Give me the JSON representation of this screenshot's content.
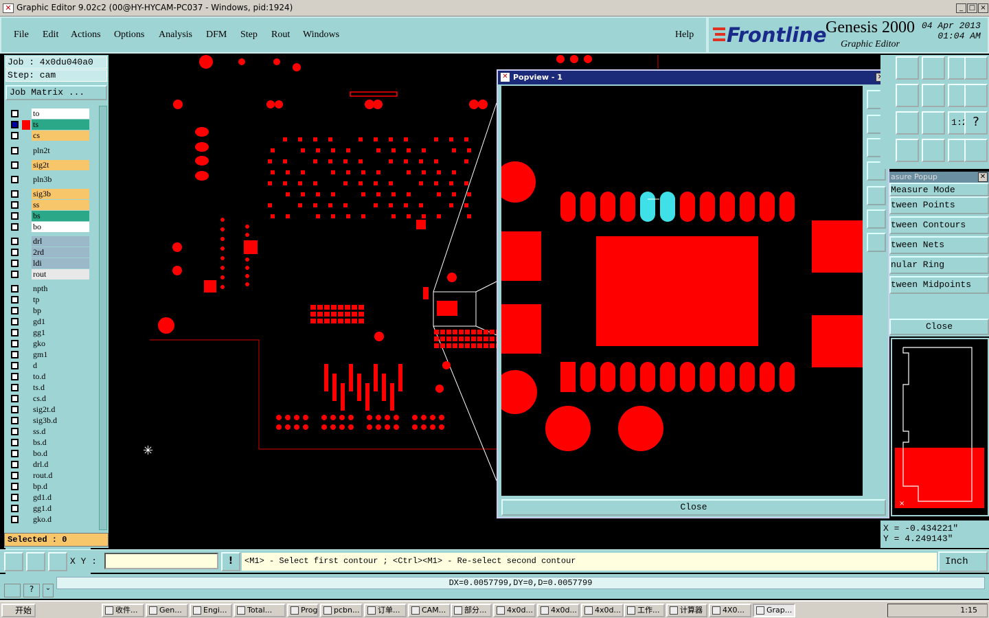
{
  "window": {
    "title": "Graphic Editor 9.02c2 (00@HY-HYCAM-PC037 - Windows, pid:1924)",
    "icon": "app-x-icon",
    "min": "_",
    "max": "□",
    "close": "×"
  },
  "menu": {
    "file": "File",
    "edit": "Edit",
    "actions": "Actions",
    "options": "Options",
    "analysis": "Analysis",
    "dfm": "DFM",
    "step": "Step",
    "rout": "Rout",
    "windows": "Windows",
    "help": "Help"
  },
  "brand": {
    "logo": "Frontline",
    "product": "Genesis 2000",
    "subtitle": "Graphic Editor",
    "date": "04 Apr 2013",
    "time": "01:04 AM"
  },
  "job": {
    "job_label": "Job : 4x0du040a0",
    "step_label": "Step: cam",
    "matrix_button": "Job Matrix ..."
  },
  "layers": [
    {
      "name": "to",
      "color": "#ffffff"
    },
    {
      "name": "ts",
      "color": "#2aa888",
      "work": true
    },
    {
      "name": "cs",
      "color": "#f7c56a"
    },
    {
      "name": "pln2t",
      "color": "#9fd4d4"
    },
    {
      "name": "sig2t",
      "color": "#f7c56a"
    },
    {
      "name": "pln3b",
      "color": "#9fd4d4"
    },
    {
      "name": "sig3b",
      "color": "#f7c56a"
    },
    {
      "name": "ss",
      "color": "#f7c56a"
    },
    {
      "name": "bs",
      "color": "#2aa888"
    },
    {
      "name": "bo",
      "color": "#ffffff"
    },
    {
      "name": "drl",
      "color": "#9ab8c8"
    },
    {
      "name": "2rd",
      "color": "#9ab8c8"
    },
    {
      "name": "ldi",
      "color": "#9ab8c8"
    },
    {
      "name": "rout",
      "color": "#e8e8e8"
    },
    {
      "name": "npth",
      "color": "#9fd4d4"
    },
    {
      "name": "tp",
      "color": "#9fd4d4"
    },
    {
      "name": "bp",
      "color": "#9fd4d4"
    },
    {
      "name": "gd1",
      "color": "#9fd4d4"
    },
    {
      "name": "gg1",
      "color": "#9fd4d4"
    },
    {
      "name": "gko",
      "color": "#9fd4d4"
    },
    {
      "name": "gm1",
      "color": "#9fd4d4"
    },
    {
      "name": "d",
      "color": "#9fd4d4"
    },
    {
      "name": "to.d",
      "color": "#9fd4d4"
    },
    {
      "name": "ts.d",
      "color": "#9fd4d4"
    },
    {
      "name": "cs.d",
      "color": "#9fd4d4"
    },
    {
      "name": "sig2t.d",
      "color": "#9fd4d4"
    },
    {
      "name": "sig3b.d",
      "color": "#9fd4d4"
    },
    {
      "name": "ss.d",
      "color": "#9fd4d4"
    },
    {
      "name": "bs.d",
      "color": "#9fd4d4"
    },
    {
      "name": "bo.d",
      "color": "#9fd4d4"
    },
    {
      "name": "drl.d",
      "color": "#9fd4d4"
    },
    {
      "name": "rout.d",
      "color": "#9fd4d4"
    },
    {
      "name": "bp.d",
      "color": "#9fd4d4"
    },
    {
      "name": "gd1.d",
      "color": "#9fd4d4"
    },
    {
      "name": "gg1.d",
      "color": "#9fd4d4"
    },
    {
      "name": "gko.d",
      "color": "#9fd4d4"
    }
  ],
  "selected": "Selected : 0",
  "popview": {
    "title": "Popview - 1",
    "close_button": "Close"
  },
  "measure": {
    "title": "asure Popup",
    "items": [
      "Measure Mode",
      "tween Points",
      "tween Contours",
      "tween Nets",
      "nular Ring",
      "tween Midpoints"
    ],
    "close_button": "Close"
  },
  "coords": {
    "x": "X = -0.434221\"",
    "y": "Y = 4.249143\""
  },
  "cmd": {
    "xy_label": "X Y :",
    "xy_value": "",
    "prompt": "<M1> - Select first contour ; <Ctrl><M1> - Re-select second contour",
    "unit": "Inch"
  },
  "status": {
    "delta": "DX=0.0057799,DY=0,D=0.0057799"
  },
  "taskbar": {
    "start": "开始",
    "tasks": [
      "收件...",
      "Gen...",
      "Engi...",
      "Total...",
      "Prog...",
      "pcbn...",
      "订单...",
      "CAM...",
      "部分...",
      "4x0d...",
      "4x0d...",
      "4x0d...",
      "工作...",
      "计算器",
      "4X0...",
      "Grap..."
    ],
    "clock": "1:15"
  },
  "colors": {
    "teal": "#9fd4d4",
    "copper": "#ff0000",
    "highlight": "#40e0e8",
    "titlebar": "#1c2a7a"
  }
}
